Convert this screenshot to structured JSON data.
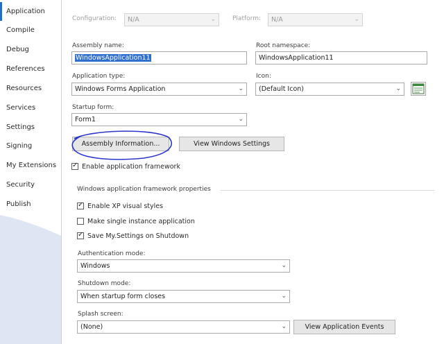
{
  "sidebar": {
    "items": [
      {
        "label": "Application",
        "active": true
      },
      {
        "label": "Compile"
      },
      {
        "label": "Debug"
      },
      {
        "label": "References"
      },
      {
        "label": "Resources"
      },
      {
        "label": "Services"
      },
      {
        "label": "Settings"
      },
      {
        "label": "Signing"
      },
      {
        "label": "My Extensions"
      },
      {
        "label": "Security"
      },
      {
        "label": "Publish"
      }
    ]
  },
  "top": {
    "configuration_label": "Configuration:",
    "configuration_value": "N/A",
    "platform_label": "Platform:",
    "platform_value": "N/A"
  },
  "form": {
    "assembly_name_label": "Assembly name:",
    "assembly_name_value": "WindowsApplication11",
    "root_namespace_label": "Root namespace:",
    "root_namespace_value": "WindowsApplication11",
    "application_type_label": "Application type:",
    "application_type_value": "Windows Forms Application",
    "icon_label": "Icon:",
    "icon_value": "(Default Icon)",
    "startup_form_label": "Startup form:",
    "startup_form_value": "Form1",
    "assembly_info_button": "Assembly Information...",
    "view_windows_settings_button": "View Windows Settings",
    "enable_framework_label": "Enable application framework"
  },
  "framework": {
    "group_title": "Windows application framework properties",
    "xp_styles_label": "Enable XP visual styles",
    "single_instance_label": "Make single instance application",
    "save_settings_label": "Save My.Settings on Shutdown",
    "auth_mode_label": "Authentication mode:",
    "auth_mode_value": "Windows",
    "shutdown_mode_label": "Shutdown mode:",
    "shutdown_mode_value": "When startup form closes",
    "splash_screen_label": "Splash screen:",
    "splash_screen_value": "(None)",
    "view_app_events_button": "View Application Events"
  },
  "colors": {
    "highlight_circle": "#2b35c9",
    "selection": "#2f6fd0",
    "sidebar_bg": "#dde6f2"
  }
}
